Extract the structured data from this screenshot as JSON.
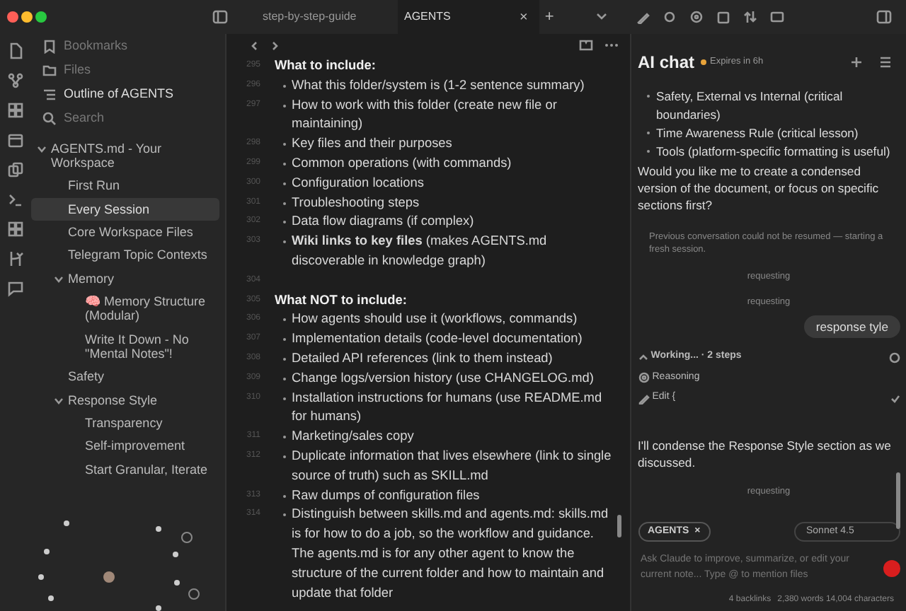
{
  "tabs": [
    {
      "label": "step-by-step-guide",
      "selected": false
    },
    {
      "label": "AGENTS",
      "selected": true
    }
  ],
  "tab_controls": {
    "close": "×",
    "new_tab": "+"
  },
  "sidebar": {
    "views": [
      {
        "label": "Bookmarks",
        "kind": "bookmark",
        "selected": false
      },
      {
        "label": "Files",
        "kind": "folder",
        "selected": false
      },
      {
        "label": "Outline of AGENTS",
        "kind": "outline",
        "selected": true
      },
      {
        "label": "Search",
        "kind": "search",
        "selected": false
      }
    ],
    "outline": [
      {
        "label": "AGENTS.md - Your Workspace",
        "selected": false,
        "expanded": true,
        "children": [
          {
            "label": "First Run",
            "selected": false
          },
          {
            "label": "Every Session",
            "selected": true
          },
          {
            "label": "Core Workspace Files",
            "selected": false
          },
          {
            "label": "Telegram Topic Contexts",
            "selected": false
          },
          {
            "label": "Memory",
            "selected": false,
            "expanded": true,
            "children": [
              {
                "label": "Memory Structure (Modular)",
                "selected": false,
                "emoji": "🧠"
              },
              {
                "label": "Write It Down - No \"Mental Notes\"!",
                "selected": false
              }
            ]
          },
          {
            "label": "Safety",
            "selected": false
          },
          {
            "label": "Response Style",
            "selected": false,
            "expanded": true,
            "children": [
              {
                "label": "Transparency",
                "selected": false
              },
              {
                "label": "Self-improvement",
                "selected": false
              },
              {
                "label": "Start Granular, Iterate",
                "selected": false
              }
            ]
          }
        ]
      }
    ]
  },
  "editor": {
    "lines": [
      {
        "number": "295",
        "kind": "heading",
        "text": "What to include:"
      },
      {
        "number": "296",
        "kind": "bullet",
        "text": "What this folder/system is (1-2 sentence summary)"
      },
      {
        "number": "297",
        "kind": "bullet",
        "text": "How to work with this folder (create new file or maintaining)"
      },
      {
        "number": "298",
        "kind": "bullet",
        "text": "Key files and their purposes"
      },
      {
        "number": "299",
        "kind": "bullet",
        "text": "Common operations (with commands)"
      },
      {
        "number": "300",
        "kind": "bullet",
        "text": "Configuration locations"
      },
      {
        "number": "301",
        "kind": "bullet",
        "text": "Troubleshooting steps"
      },
      {
        "number": "302",
        "kind": "bullet",
        "text": "Data flow diagrams (if complex)"
      },
      {
        "number": "303",
        "kind": "bullet",
        "text": "**Wiki links to key files** (makes AGENTS.md discoverable in knowledge graph)"
      },
      {
        "number": "304",
        "kind": "blank"
      },
      {
        "number": "305",
        "kind": "heading",
        "text": "What NOT to include:"
      },
      {
        "number": "306",
        "kind": "bullet",
        "text": "How agents should use it (workflows, commands)"
      },
      {
        "number": "307",
        "kind": "bullet",
        "text": "Implementation details (code-level documentation)"
      },
      {
        "number": "308",
        "kind": "bullet",
        "text": "Detailed API references (link to them instead)"
      },
      {
        "number": "309",
        "kind": "bullet",
        "text": "Change logs/version history (use CHANGELOG.md)"
      },
      {
        "number": "310",
        "kind": "bullet",
        "text": "Installation instructions for humans (use README.md for humans)"
      },
      {
        "number": "311",
        "kind": "bullet",
        "text": "Marketing/sales copy"
      },
      {
        "number": "312",
        "kind": "bullet",
        "text": "Duplicate information that lives elsewhere (link to single source of truth) such as SKILL.md"
      },
      {
        "number": "313",
        "kind": "bullet",
        "text": "Raw dumps of configuration files"
      },
      {
        "number": "314",
        "kind": "bullet",
        "text": "Distinguish between skills.md and agents.md: skills.md is for how to do a job, so the workflow and guidance. The agents.md is for any other agent to know the structure of the current folder and how to maintain and update that folder"
      }
    ]
  },
  "chat": {
    "title": "AI chat",
    "expiry": "Expires in 6h",
    "bullets": [
      "Safety, External vs Internal (critical boundaries)",
      "Time Awareness Rule (critical lesson)",
      "Tools (platform-specific formatting is useful)"
    ],
    "question": "Would you like me to create a condensed version of the document, or focus on specific sections first?",
    "notice": "Previous conversation could not be resumed — starting a fresh session.",
    "status_1": "requesting",
    "status_2": "requesting",
    "user_message": "response tyle",
    "working": {
      "label": "Working... · 2 steps",
      "expanded": true,
      "steps": [
        {
          "kind": "reasoning",
          "label": "Reasoning"
        },
        {
          "kind": "edit",
          "label": "Edit {"
        }
      ]
    },
    "reply": "I'll condense the Response Style section as we discussed.",
    "status_3": "requesting",
    "context_chip": "AGENTS",
    "model": "Sonnet 4.5",
    "input_placeholder": "Ask Claude to improve, summarize, or edit your current note... Type @ to mention files"
  },
  "status_bar": {
    "backlinks": "4 backlinks",
    "counts": "2,380 words 14,004 characters"
  }
}
